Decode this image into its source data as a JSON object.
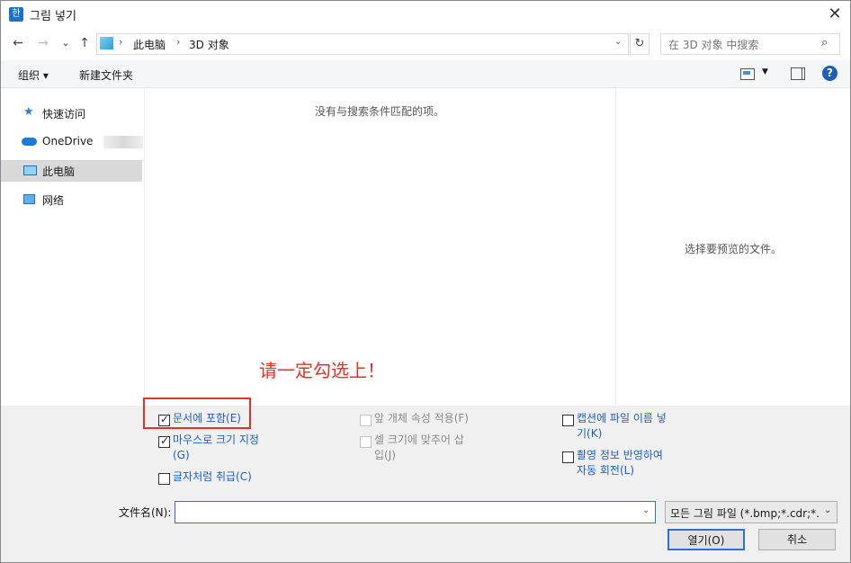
{
  "window": {
    "title": "그림 넣기",
    "app_icon": "한",
    "close_label": "✕"
  },
  "nav": {
    "back": "←",
    "forward": "→",
    "recent": "⌄",
    "up": "↑",
    "breadcrumb": [
      "此电脑",
      "3D 对象"
    ],
    "separator": "›",
    "refresh": "↻",
    "search_placeholder": "在 3D 对象 中搜索"
  },
  "toolbar": {
    "organize_label": "组织 ▾",
    "new_folder_label": "新建文件夹"
  },
  "sidebar": {
    "items": [
      {
        "label": "快速访问",
        "icon": "star-pin-icon"
      },
      {
        "label": "OneDrive",
        "icon": "cloud-icon"
      },
      {
        "label": "此电脑",
        "icon": "computer-icon",
        "selected": true
      },
      {
        "label": "网络",
        "icon": "network-icon"
      }
    ]
  },
  "content": {
    "empty_message": "没有与搜索条件匹配的项。"
  },
  "preview": {
    "message": "选择要预览的文件。"
  },
  "annotation": {
    "text": "请一定勾选上！",
    "color": "#e8302a"
  },
  "options": {
    "col1": [
      {
        "label": "문서에 포함(E)",
        "checked": true,
        "enabled": true
      },
      {
        "label_line1": "마우스로 크기 지정",
        "label_line2": "(G)",
        "checked": true,
        "enabled": true
      },
      {
        "label": "글자처럼 취급(C)",
        "checked": false,
        "enabled": true
      }
    ],
    "col2": [
      {
        "label": "앞 개체 속성 적용(F)",
        "checked": false,
        "enabled": false
      },
      {
        "label_line1": "셀 크기에 맞추어 삽",
        "label_line2": "입(J)",
        "checked": false,
        "enabled": false
      }
    ],
    "col3": [
      {
        "label_line1": "캡션에 파일 이름 넣",
        "label_line2": "기(K)",
        "checked": false,
        "enabled": true
      },
      {
        "label_line1": "촬영 정보 반영하여",
        "label_line2": "자동 회전(L)",
        "checked": false,
        "enabled": true
      }
    ]
  },
  "filename": {
    "label": "文件名(N):",
    "value": ""
  },
  "filetype": {
    "selected": "모든 그림 파일 (*.bmp;*.cdr;*."
  },
  "buttons": {
    "open": "열기(O)",
    "cancel": "취소"
  },
  "colors": {
    "accent": "#2f6fd6",
    "link": "#1f5fbf",
    "highlight_box": "#e3312b"
  }
}
